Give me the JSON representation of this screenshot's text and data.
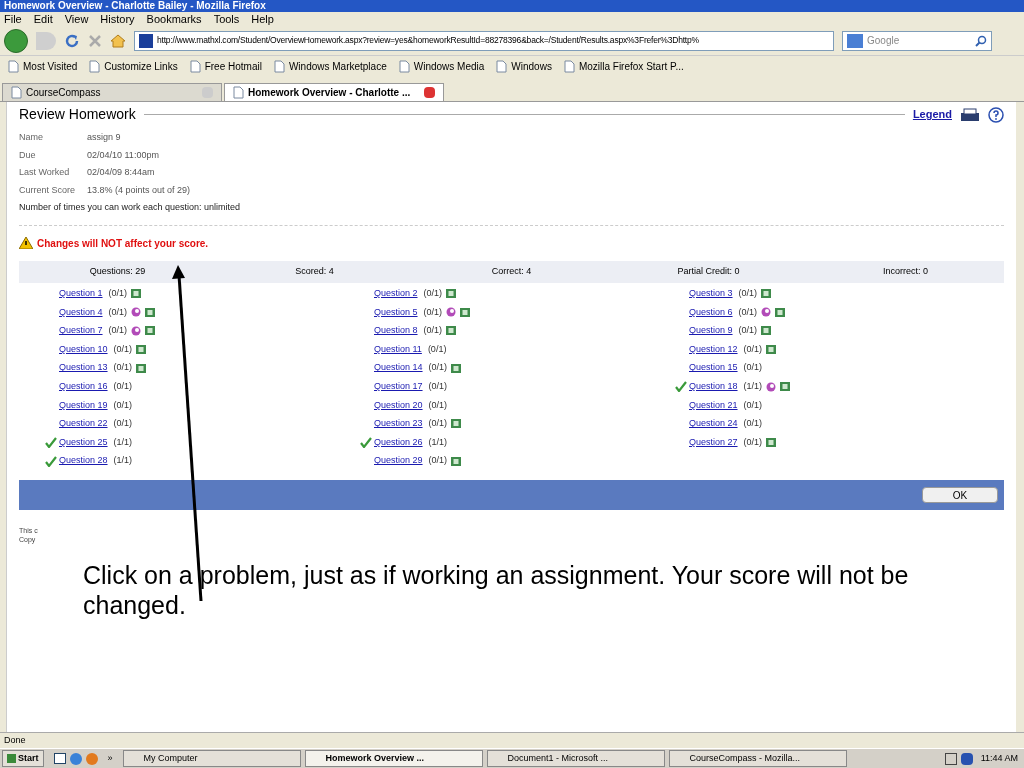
{
  "window": {
    "title": "Homework Overview - Charlotte Bailey - Mozilla Firefox"
  },
  "menu": [
    "File",
    "Edit",
    "View",
    "History",
    "Bookmarks",
    "Tools",
    "Help"
  ],
  "address": {
    "value": "http://www.mathxl.com/Student/OverviewHomework.aspx?review=yes&homeworkResultId=88278396&back=/Student/Results.aspx%3Frefer%3Dhttp%"
  },
  "search": {
    "placeholder": "Google"
  },
  "bookmarks": [
    "Most Visited",
    "Customize Links",
    "Free Hotmail",
    "Windows Marketplace",
    "Windows Media",
    "Windows",
    "Mozilla Firefox Start P..."
  ],
  "tabs": [
    {
      "label": "CourseCompass",
      "selected": false
    },
    {
      "label": "Homework Overview - Charlotte ...",
      "selected": true
    }
  ],
  "page": {
    "heading": "Review Homework",
    "legend": "Legend",
    "info": [
      {
        "label": "Name",
        "value": "assign 9"
      },
      {
        "label": "Due",
        "value": "02/04/10 11:00pm"
      },
      {
        "label": "Last Worked",
        "value": "02/04/09 8:44am"
      },
      {
        "label": "Current Score",
        "value": "13.8% (4 points out of 29)"
      }
    ],
    "attempts": "Number of times you can work each question: unlimited",
    "warning": "Changes will NOT affect your score.",
    "summary": [
      "Questions: 29",
      "Scored: 4",
      "Correct: 4",
      "Partial Credit: 0",
      "Incorrect: 0"
    ],
    "questions": [
      {
        "label": "Question 1",
        "score": "(0/1)",
        "correct": false,
        "help": false,
        "video": true
      },
      {
        "label": "Question 2",
        "score": "(0/1)",
        "correct": false,
        "help": false,
        "video": true
      },
      {
        "label": "Question 3",
        "score": "(0/1)",
        "correct": false,
        "help": false,
        "video": true
      },
      {
        "label": "Question 4",
        "score": "(0/1)",
        "correct": false,
        "help": true,
        "video": true
      },
      {
        "label": "Question 5",
        "score": "(0/1)",
        "correct": false,
        "help": true,
        "video": true
      },
      {
        "label": "Question 6",
        "score": "(0/1)",
        "correct": false,
        "help": true,
        "video": true
      },
      {
        "label": "Question 7",
        "score": "(0/1)",
        "correct": false,
        "help": true,
        "video": true
      },
      {
        "label": "Question 8",
        "score": "(0/1)",
        "correct": false,
        "help": false,
        "video": true
      },
      {
        "label": "Question 9",
        "score": "(0/1)",
        "correct": false,
        "help": false,
        "video": true
      },
      {
        "label": "Question 10",
        "score": "(0/1)",
        "correct": false,
        "help": false,
        "video": true
      },
      {
        "label": "Question 11",
        "score": "(0/1)",
        "correct": false,
        "help": false,
        "video": false
      },
      {
        "label": "Question 12",
        "score": "(0/1)",
        "correct": false,
        "help": false,
        "video": true
      },
      {
        "label": "Question 13",
        "score": "(0/1)",
        "correct": false,
        "help": false,
        "video": true
      },
      {
        "label": "Question 14",
        "score": "(0/1)",
        "correct": false,
        "help": false,
        "video": true
      },
      {
        "label": "Question 15",
        "score": "(0/1)",
        "correct": false,
        "help": false,
        "video": false
      },
      {
        "label": "Question 16",
        "score": "(0/1)",
        "correct": false,
        "help": false,
        "video": false
      },
      {
        "label": "Question 17",
        "score": "(0/1)",
        "correct": false,
        "help": false,
        "video": false
      },
      {
        "label": "Question 18",
        "score": "(1/1)",
        "correct": true,
        "help": true,
        "video": true
      },
      {
        "label": "Question 19",
        "score": "(0/1)",
        "correct": false,
        "help": false,
        "video": false
      },
      {
        "label": "Question 20",
        "score": "(0/1)",
        "correct": false,
        "help": false,
        "video": false
      },
      {
        "label": "Question 21",
        "score": "(0/1)",
        "correct": false,
        "help": false,
        "video": false
      },
      {
        "label": "Question 22",
        "score": "(0/1)",
        "correct": false,
        "help": false,
        "video": false
      },
      {
        "label": "Question 23",
        "score": "(0/1)",
        "correct": false,
        "help": false,
        "video": true
      },
      {
        "label": "Question 24",
        "score": "(0/1)",
        "correct": false,
        "help": false,
        "video": false
      },
      {
        "label": "Question 25",
        "score": "(1/1)",
        "correct": true,
        "help": false,
        "video": false
      },
      {
        "label": "Question 26",
        "score": "(1/1)",
        "correct": true,
        "help": false,
        "video": false
      },
      {
        "label": "Question 27",
        "score": "(0/1)",
        "correct": false,
        "help": false,
        "video": true
      },
      {
        "label": "Question 28",
        "score": "(1/1)",
        "correct": true,
        "help": false,
        "video": false
      },
      {
        "label": "Question 29",
        "score": "(0/1)",
        "correct": false,
        "help": false,
        "video": true
      }
    ],
    "ok": "OK",
    "footer": [
      "This c",
      "Copy"
    ]
  },
  "callout": "Click on a problem, just as if working an assignment.  Your score will not be changed.",
  "status_bar": "Done",
  "taskbar": {
    "start": "Start",
    "more": "»",
    "tasks": [
      {
        "label": "My Computer",
        "selected": false
      },
      {
        "label": "Homework Overview ...",
        "selected": true
      },
      {
        "label": "Document1 - Microsoft ...",
        "selected": false
      },
      {
        "label": "CourseCompass - Mozilla...",
        "selected": false
      }
    ],
    "clock": "11:44 AM"
  }
}
